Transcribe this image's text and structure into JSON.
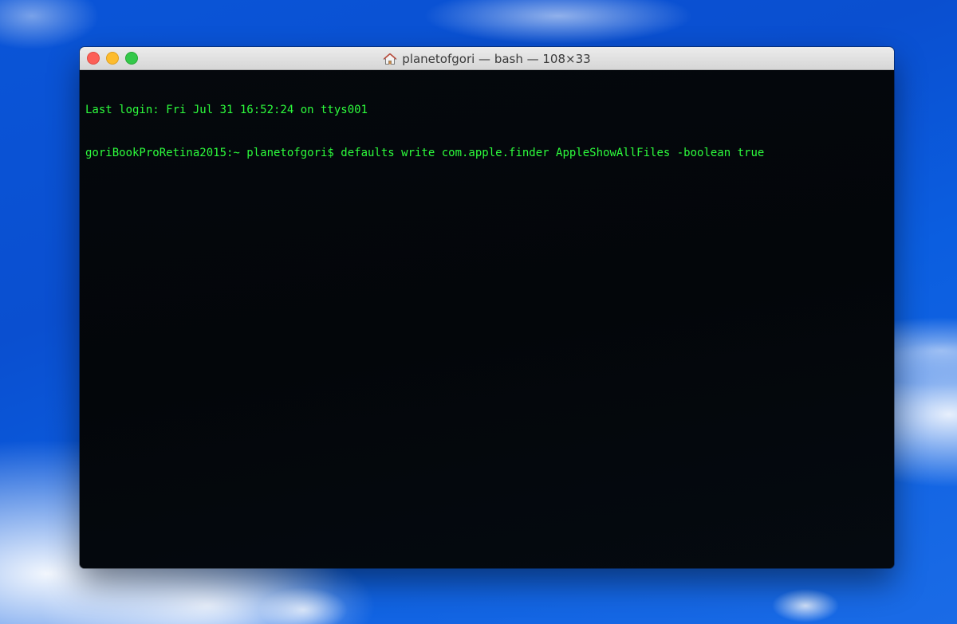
{
  "window": {
    "title": "planetofgori — bash — 108×33",
    "icon": "home-icon"
  },
  "terminal": {
    "lines": [
      "Last login: Fri Jul 31 16:52:24 on ttys001",
      "goriBookProRetina2015:~ planetofgori$ defaults write com.apple.finder AppleShowAllFiles -boolean true"
    ],
    "text_color": "#2dfc3c",
    "background_color": "#04070b"
  },
  "traffic_lights": {
    "close_color": "#fc5f57",
    "minimize_color": "#fdbc2e",
    "maximize_color": "#34c84a"
  }
}
